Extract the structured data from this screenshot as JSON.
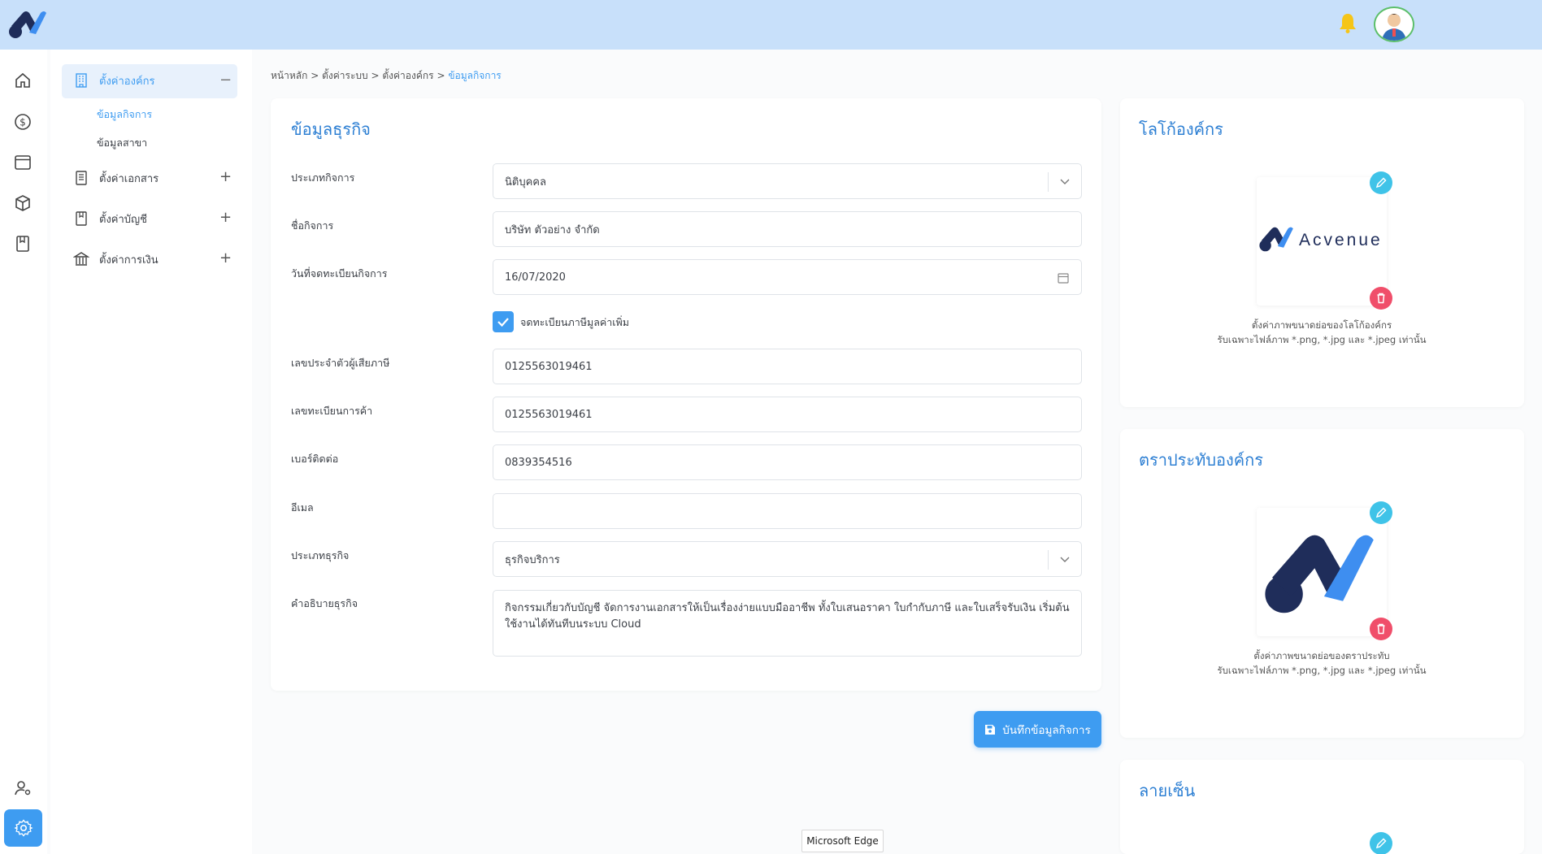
{
  "breadcrumb": {
    "home": "หน้าหลัก",
    "sep": ">",
    "system": "ตั้งค่าระบบ",
    "org": "ตั้งค่าองค์กร",
    "current": "ข้อมูลกิจการ"
  },
  "menu": {
    "org_settings": "ตั้งค่าองค์กร",
    "business_info": "ข้อมูลกิจการ",
    "branch_info": "ข้อมูลสาขา",
    "document_settings": "ตั้งค่าเอกสาร",
    "account_settings": "ตั้งค่าบัญชี",
    "finance_settings": "ตั้งค่าการเงิน",
    "collapse": "−",
    "expand": "+"
  },
  "business_card": {
    "title": "ข้อมูลธุรกิจ",
    "fields": {
      "business_type_label": "ประเภทกิจการ",
      "business_type_value": "นิติบุคคล",
      "business_name_label": "ชื่อกิจการ",
      "business_name_value": "บริษัท ตัวอย่าง จำกัด",
      "reg_date_label": "วันที่จดทะเบียนกิจการ",
      "reg_date_value": "16/07/2020",
      "vat_label": "จดทะเบียนภาษีมูลค่าเพิ่ม",
      "tax_id_label": "เลขประจำตัวผู้เสียภาษี",
      "tax_id_value": "0125563019461",
      "commerce_no_label": "เลขทะเบียนการค้า",
      "commerce_no_value": "0125563019461",
      "phone_label": "เบอร์ติดต่อ",
      "phone_value": "0839354516",
      "email_label": "อีเมล",
      "email_value": "",
      "category_label": "ประเภทธุรกิจ",
      "category_value": "ธุรกิจบริการ",
      "desc_label": "คำอธิบายธุรกิจ",
      "desc_value": "กิจกรรมเกี่ยวกับบัญชี จัดการงานเอกสารให้เป็นเรื่องง่ายแบบมืออาชีพ ทั้งใบเสนอราคา ใบกำกับภาษี และใบเสร็จรับเงิน เริ่มต้นใช้งานได้ทันทีบนระบบ Cloud"
    },
    "save_label": "บันทึกข้อมูลกิจการ"
  },
  "logo_card": {
    "title": "โลโก้องค์กร",
    "brand_text": "Acvenue",
    "note_line1": "ตั้งค่าภาพขนาดย่อของโลโก้องค์กร",
    "note_line2": "รับเฉพาะไฟล์ภาพ *.png, *.jpg และ *.jpeg เท่านั้น"
  },
  "stamp_card": {
    "title": "ตราประทับองค์กร",
    "note_line1": "ตั้งค่าภาพขนาดย่อของตราประทับ",
    "note_line2": "รับเฉพาะไฟล์ภาพ *.png, *.jpg และ *.jpeg เท่านั้น"
  },
  "signature_card": {
    "title": "ลายเซ็น"
  },
  "tooltip": "Microsoft Edge",
  "colors": {
    "accent": "#3e9cf1",
    "topbar": "#c8e0fa",
    "title": "#2d7fd3",
    "edit": "#3fc3e8",
    "delete": "#f04e6a",
    "logo_dark": "#1f2d5a"
  },
  "icons": {
    "rail": [
      "home-icon",
      "dollar-icon",
      "window-icon",
      "box-icon",
      "book-icon",
      "user-settings-icon",
      "gear-icon"
    ],
    "topbar": [
      "bell-icon",
      "avatar"
    ]
  }
}
